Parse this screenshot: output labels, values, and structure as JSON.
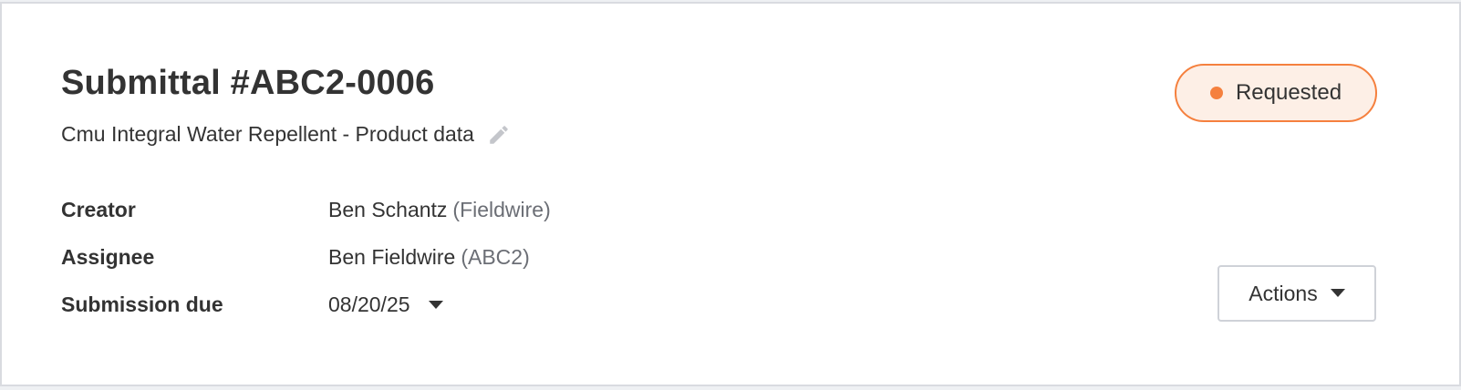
{
  "submittal": {
    "title": "Submittal #ABC2-0006",
    "subtitle": "Cmu Integral Water Repellent - Product data",
    "edit_icon": "pencil-icon"
  },
  "status": {
    "label": "Requested",
    "color": "#f5803e",
    "background": "#fdefe6"
  },
  "fields": {
    "creator": {
      "label": "Creator",
      "name": "Ben Schantz",
      "org": "(Fieldwire)"
    },
    "assignee": {
      "label": "Assignee",
      "name": "Ben Fieldwire",
      "org": "(ABC2)"
    },
    "submission_due": {
      "label": "Submission due",
      "value": "08/20/25",
      "icon": "caret-down-icon"
    }
  },
  "actions": {
    "label": "Actions",
    "icon": "caret-down-icon"
  }
}
